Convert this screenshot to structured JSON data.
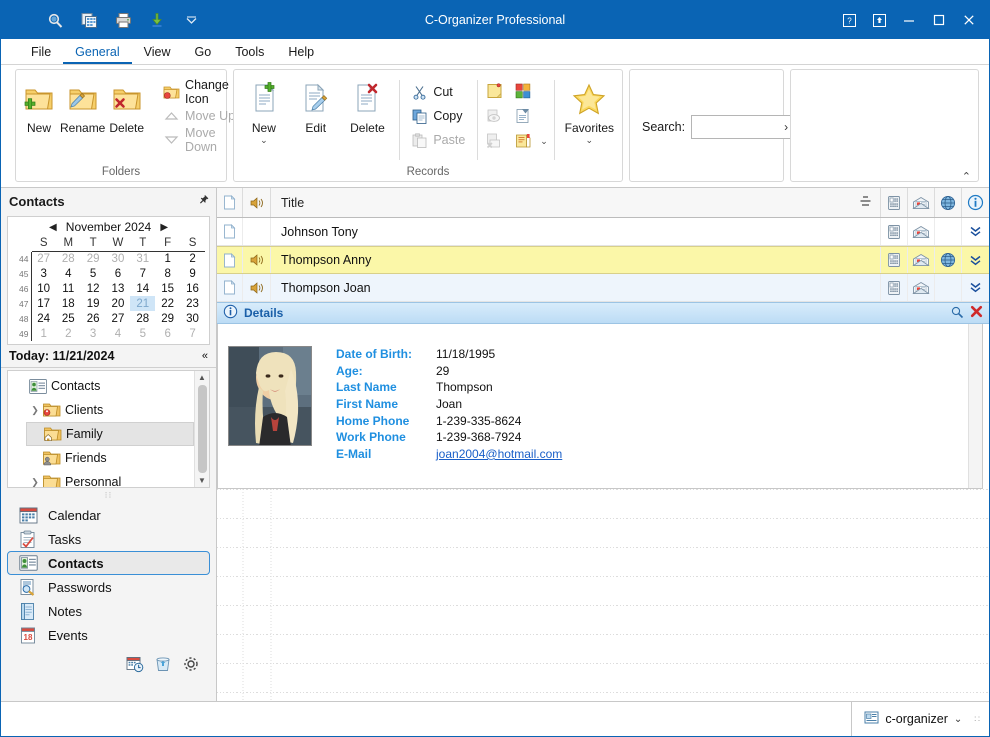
{
  "window": {
    "title": "C-Organizer Professional",
    "quick_access": [
      "search-icon",
      "copy-records-icon",
      "print-icon",
      "import-icon",
      "customize-chevron-icon"
    ],
    "controls": [
      "help-button",
      "restore-down-button",
      "minimize-button",
      "maximize-button",
      "close-button"
    ]
  },
  "menu": {
    "items": [
      {
        "label": "File",
        "active": false
      },
      {
        "label": "General",
        "active": true
      },
      {
        "label": "View",
        "active": false
      },
      {
        "label": "Go",
        "active": false
      },
      {
        "label": "Tools",
        "active": false
      },
      {
        "label": "Help",
        "active": false
      }
    ]
  },
  "ribbon": {
    "collapse_label": "⌃",
    "groups": [
      {
        "name": "folders",
        "label": "Folders",
        "big_buttons": [
          {
            "label": "New",
            "icon": "folder-new-icon",
            "enabled": true
          },
          {
            "label": "Rename",
            "icon": "folder-rename-icon",
            "enabled": true
          },
          {
            "label": "Delete",
            "icon": "folder-delete-icon",
            "enabled": true
          }
        ],
        "small_buttons": [
          {
            "label": "Change Icon",
            "icon": "change-icon-icon",
            "enabled": true,
            "has_caret": true
          },
          {
            "label": "Move Up",
            "icon": "move-up-icon",
            "enabled": false,
            "has_caret": false
          },
          {
            "label": "Move Down",
            "icon": "move-down-icon",
            "enabled": false,
            "has_caret": false
          }
        ]
      },
      {
        "name": "records",
        "label": "Records",
        "big_buttons": [
          {
            "label": "New",
            "icon": "record-new-icon",
            "enabled": true,
            "has_caret": true
          },
          {
            "label": "Edit",
            "icon": "record-edit-icon",
            "enabled": true
          },
          {
            "label": "Delete",
            "icon": "record-delete-icon",
            "enabled": true
          }
        ],
        "small_buttons": [
          {
            "label": "Cut",
            "icon": "cut-icon",
            "enabled": true
          },
          {
            "label": "Copy",
            "icon": "copy-icon",
            "enabled": true
          },
          {
            "label": "Paste",
            "icon": "paste-icon",
            "enabled": false
          }
        ],
        "icon_grid": [
          [
            "sticky-note-icon",
            "tiles-view-icon"
          ],
          [
            "preview-icon",
            "template-icon"
          ],
          [
            "delete-print-icon",
            "send-mail-icon"
          ]
        ],
        "favorites": {
          "label": "Favorites",
          "icon": "star-icon",
          "has_caret": true
        }
      },
      {
        "name": "search",
        "label": "",
        "search_label": "Search:",
        "search_value": "",
        "search_placeholder": "",
        "search_go": "›"
      }
    ]
  },
  "sidebar": {
    "header": {
      "title": "Contacts",
      "pin_icon": "pin-icon"
    },
    "calendar": {
      "month_label": "November 2024",
      "prev_icon": "◀",
      "next_icon": "▶",
      "daynames": [
        "S",
        "M",
        "T",
        "W",
        "T",
        "F",
        "S"
      ],
      "weeks": [
        {
          "num": "44",
          "days": [
            {
              "d": "27",
              "t": "out"
            },
            {
              "d": "28",
              "t": "out"
            },
            {
              "d": "29",
              "t": "out"
            },
            {
              "d": "30",
              "t": "out"
            },
            {
              "d": "31",
              "t": "out"
            },
            {
              "d": "1",
              "t": "in"
            },
            {
              "d": "2",
              "t": "in"
            }
          ]
        },
        {
          "num": "45",
          "days": [
            {
              "d": "3",
              "t": "in"
            },
            {
              "d": "4",
              "t": "in"
            },
            {
              "d": "5",
              "t": "in"
            },
            {
              "d": "6",
              "t": "in"
            },
            {
              "d": "7",
              "t": "in"
            },
            {
              "d": "8",
              "t": "in"
            },
            {
              "d": "9",
              "t": "in"
            }
          ]
        },
        {
          "num": "46",
          "days": [
            {
              "d": "10",
              "t": "in"
            },
            {
              "d": "11",
              "t": "in"
            },
            {
              "d": "12",
              "t": "in"
            },
            {
              "d": "13",
              "t": "in"
            },
            {
              "d": "14",
              "t": "in"
            },
            {
              "d": "15",
              "t": "in"
            },
            {
              "d": "16",
              "t": "in"
            }
          ]
        },
        {
          "num": "47",
          "days": [
            {
              "d": "17",
              "t": "in"
            },
            {
              "d": "18",
              "t": "in"
            },
            {
              "d": "19",
              "t": "in"
            },
            {
              "d": "20",
              "t": "in"
            },
            {
              "d": "21",
              "t": "today"
            },
            {
              "d": "22",
              "t": "in"
            },
            {
              "d": "23",
              "t": "in"
            }
          ]
        },
        {
          "num": "48",
          "days": [
            {
              "d": "24",
              "t": "in"
            },
            {
              "d": "25",
              "t": "in"
            },
            {
              "d": "26",
              "t": "in"
            },
            {
              "d": "27",
              "t": "in"
            },
            {
              "d": "28",
              "t": "in"
            },
            {
              "d": "29",
              "t": "in"
            },
            {
              "d": "30",
              "t": "in"
            }
          ]
        },
        {
          "num": "49",
          "days": [
            {
              "d": "1",
              "t": "out"
            },
            {
              "d": "2",
              "t": "out"
            },
            {
              "d": "3",
              "t": "out"
            },
            {
              "d": "4",
              "t": "out"
            },
            {
              "d": "5",
              "t": "out"
            },
            {
              "d": "6",
              "t": "out"
            },
            {
              "d": "7",
              "t": "out"
            }
          ]
        }
      ],
      "today_label": "Today: 11/21/2024",
      "collapse_icon": "«"
    },
    "tree": {
      "root": {
        "label": "Contacts",
        "icon": "contacts-card-icon"
      },
      "nodes": [
        {
          "label": "Clients",
          "icon": "folder-clients-icon",
          "expandable": true,
          "selected": false
        },
        {
          "label": "Family",
          "icon": "folder-family-icon",
          "expandable": false,
          "selected": true
        },
        {
          "label": "Friends",
          "icon": "folder-friends-icon",
          "expandable": false,
          "selected": false
        },
        {
          "label": "Personnal",
          "icon": "folder-plain-icon",
          "expandable": true,
          "selected": false
        }
      ]
    },
    "nav": {
      "items": [
        {
          "label": "Calendar",
          "icon": "calendar-icon",
          "selected": false
        },
        {
          "label": "Tasks",
          "icon": "tasks-icon",
          "selected": false
        },
        {
          "label": "Contacts",
          "icon": "contacts-icon",
          "selected": true
        },
        {
          "label": "Passwords",
          "icon": "passwords-icon",
          "selected": false
        },
        {
          "label": "Notes",
          "icon": "notes-icon",
          "selected": false
        },
        {
          "label": "Events",
          "icon": "events-icon",
          "selected": false
        }
      ],
      "bottom_icons": [
        "calendar-clock-icon",
        "recycle-bin-icon",
        "settings-gear-icon"
      ]
    }
  },
  "list": {
    "columns": {
      "doc": "document-icon",
      "sound": "sound-icon",
      "title": "Title",
      "sort_icon": "group-icon",
      "phone": "phone-icon",
      "mail": "mail-icon",
      "web": "globe-icon",
      "info": "info-icon"
    },
    "rows": [
      {
        "title": "Johnson Tony",
        "has_sound": false,
        "has_phone": true,
        "has_mail": true,
        "has_web": false,
        "state": "normal"
      },
      {
        "title": "Thompson Anny",
        "has_sound": true,
        "has_phone": true,
        "has_mail": true,
        "has_web": true,
        "state": "selected"
      },
      {
        "title": "Thompson Joan",
        "has_sound": true,
        "has_phone": true,
        "has_mail": true,
        "has_web": false,
        "state": "alt"
      }
    ],
    "expand_icon": "»"
  },
  "details": {
    "header": {
      "title": "Details",
      "icon": "info-icon",
      "find_icon": "find-icon",
      "close_icon": "close-red-icon"
    },
    "photo_alt": "contact-photo",
    "fields": [
      {
        "label": "Date of Birth:",
        "value": "11/18/1995",
        "is_link": false
      },
      {
        "label": "Age:",
        "value": "29",
        "is_link": false
      },
      {
        "label": "Last Name",
        "value": "Thompson",
        "is_link": false
      },
      {
        "label": "First Name",
        "value": "Joan",
        "is_link": false
      },
      {
        "label": "Home Phone",
        "value": "1-239-335-8624",
        "is_link": false
      },
      {
        "label": "Work Phone",
        "value": "1-239-368-7924",
        "is_link": false
      },
      {
        "label": "E-Mail",
        "value": "joan2004@hotmail.com",
        "is_link": true
      }
    ]
  },
  "statusbar": {
    "profile": {
      "label": "c-organizer",
      "icon": "database-icon",
      "caret": "⌄"
    },
    "grip": "∷"
  },
  "colors": {
    "titlebar_blue": "#0a64b4",
    "accent_blue": "#1f8fe0",
    "selected_row": "#fbf7a8",
    "alt_row": "#eef5fc",
    "link": "#1a5fc8"
  }
}
